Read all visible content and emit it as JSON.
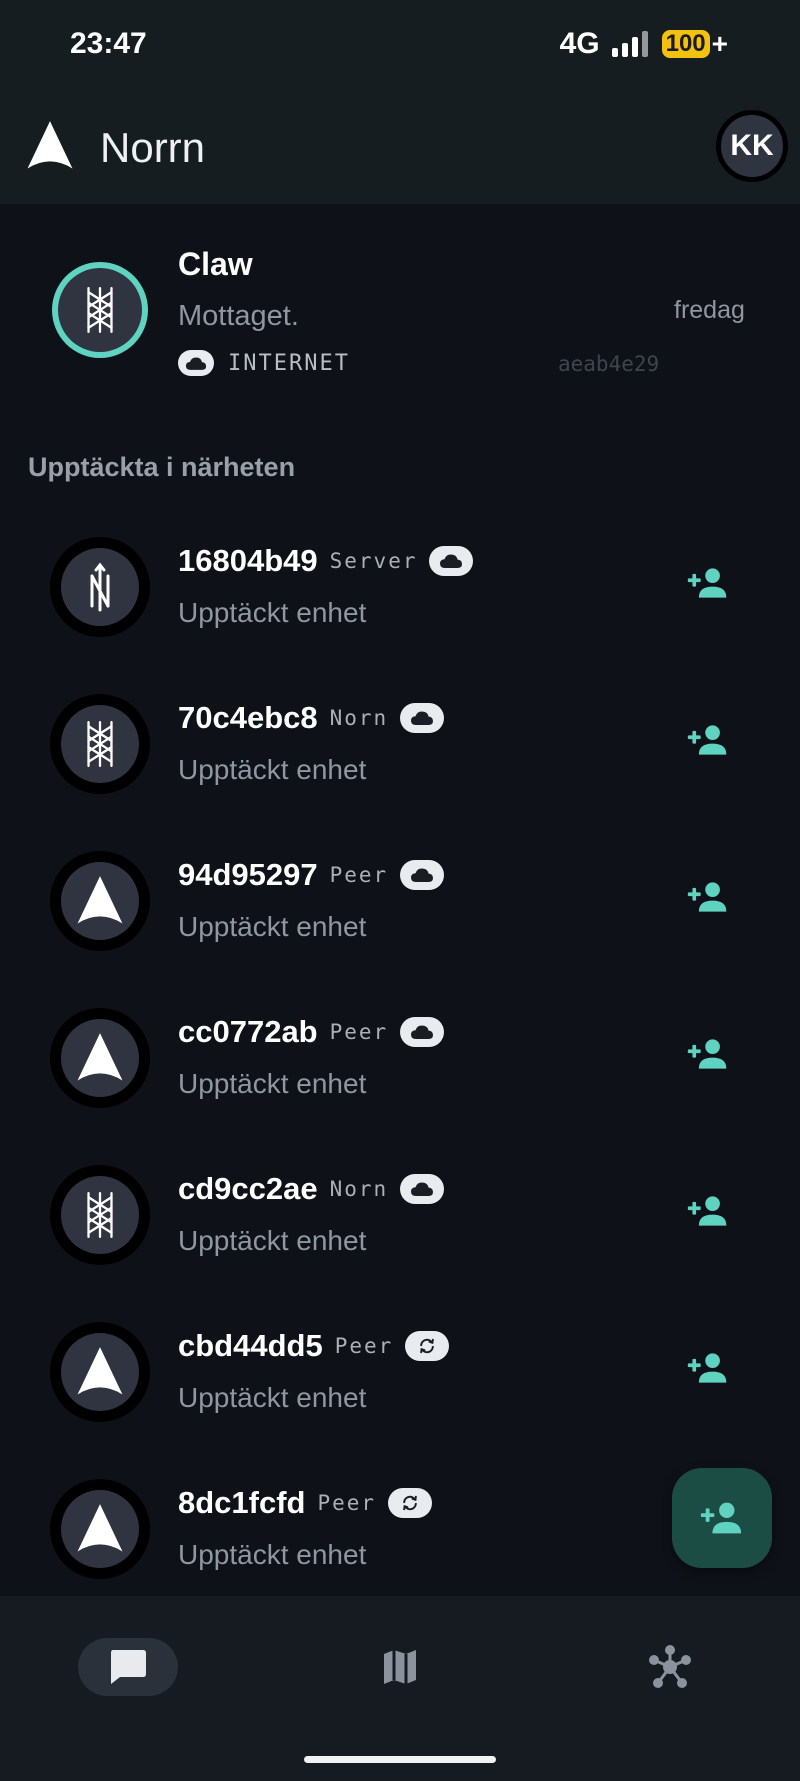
{
  "status": {
    "time": "23:47",
    "network": "4G",
    "battery": "100",
    "battery_plus": "+"
  },
  "appbar": {
    "title": "Norrn",
    "avatar_initials": "KK"
  },
  "conversation": {
    "name": "Claw",
    "message": "Mottaget.",
    "time": "fredag",
    "transport_icon": "cloud-icon",
    "transport": "INTERNET",
    "hash": "aeab4e29"
  },
  "nearby": {
    "title": "Upptäckta i närheten",
    "peers": [
      {
        "id": "16804b49",
        "type": "Server",
        "icon": "cloud-icon",
        "avatar": "n-rune",
        "subtitle": "Upptäckt enhet"
      },
      {
        "id": "70c4ebc8",
        "type": "Norn",
        "icon": "cloud-icon",
        "avatar": "lattice-rune",
        "subtitle": "Upptäckt enhet"
      },
      {
        "id": "94d95297",
        "type": "Peer",
        "icon": "cloud-icon",
        "avatar": "arrow",
        "subtitle": "Upptäckt enhet"
      },
      {
        "id": "cc0772ab",
        "type": "Peer",
        "icon": "cloud-icon",
        "avatar": "arrow",
        "subtitle": "Upptäckt enhet"
      },
      {
        "id": "cd9cc2ae",
        "type": "Norn",
        "icon": "cloud-icon",
        "avatar": "lattice-rune",
        "subtitle": "Upptäckt enhet"
      },
      {
        "id": "cbd44dd5",
        "type": "Peer",
        "icon": "sync-icon",
        "avatar": "arrow",
        "subtitle": "Upptäckt enhet"
      },
      {
        "id": "8dc1fcfd",
        "type": "Peer",
        "icon": "sync-icon",
        "avatar": "arrow",
        "subtitle": "Upptäckt enhet"
      }
    ]
  },
  "bottom_nav": [
    {
      "name": "chat-icon",
      "active": true
    },
    {
      "name": "map-icon",
      "active": false
    },
    {
      "name": "network-icon",
      "active": false
    }
  ],
  "colors": {
    "accent": "#5fd3c0",
    "background": "#0e1117",
    "bar": "#161d21",
    "fab": "#1c4d45"
  }
}
